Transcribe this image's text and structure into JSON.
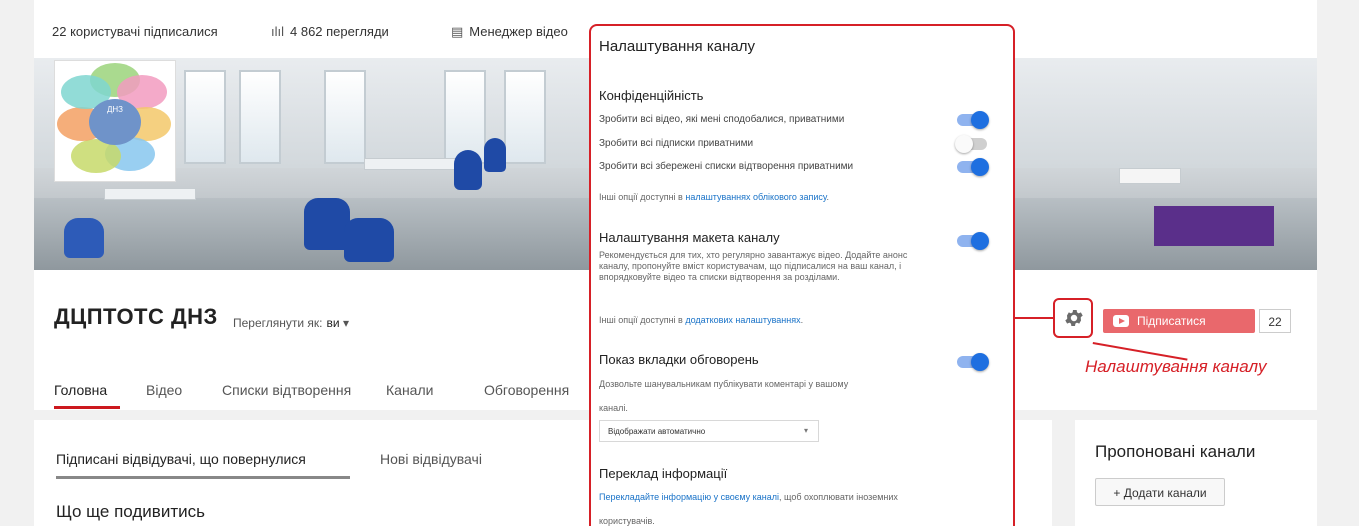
{
  "stats": {
    "subscribers": "22 користувачі підписалися",
    "views": "4 862 перегляди",
    "video_manager": "Менеджер відео"
  },
  "channel": {
    "name": "ДЦПТОТС ДНЗ",
    "view_as_label": "Переглянути як:",
    "view_as_value": "ви"
  },
  "tabs": [
    "Головна",
    "Відео",
    "Списки відтворення",
    "Канали",
    "Обговорення"
  ],
  "subscribe": {
    "label": "Підписатися",
    "count": "22"
  },
  "callout": "Налаштування каналу",
  "logo_text": "ДНЗ",
  "settings": {
    "title": "Налаштування каналу",
    "privacy_heading": "Конфіденційність",
    "privacy_rows": [
      {
        "label": "Зробити всі відео, які мені сподобалися, приватними",
        "on": true
      },
      {
        "label": "Зробити всі підписки приватними",
        "on": false
      },
      {
        "label": "Зробити всі збережені списки відтворення приватними",
        "on": true
      }
    ],
    "privacy_more_prefix": "Інші опції доступні в ",
    "privacy_more_link": "налаштуваннях облікового запису",
    "privacy_more_suffix": ".",
    "layout_heading": "Налаштування макета каналу",
    "layout_desc": "Рекомендується для тих, хто регулярно завантажує відео. Додайте анонс каналу, пропонуйте вміст користувачам, що підписалися на ваш канал, і впорядковуйте відео та списки відтворення за розділами.",
    "layout_more_prefix": "Інші опції доступні в ",
    "layout_more_link": "додаткових налаштуваннях",
    "layout_more_suffix": ".",
    "discussion_heading": "Показ вкладки обговорень",
    "discussion_desc_1": "Дозвольте шанувальникам публікувати коментарі у вашому",
    "discussion_desc_2": "каналі.",
    "discussion_dropdown": "Відображати автоматично",
    "translate_heading": "Переклад інформації",
    "translate_link": "Перекладайте інформацію у своєму каналі",
    "translate_rest": ", щоб охоплювати іноземних",
    "translate_rest_2": "користувачів."
  },
  "lower": {
    "tab_returning": "Підписані відвідувачі, що повернулися",
    "tab_new": "Нові відвідувачі",
    "more_title": "Що ще подивитись"
  },
  "side": {
    "title": "Пропоновані канали",
    "add_button": "+ Додати канали"
  },
  "colors": {
    "accent_red": "#d62027",
    "toggle_blue": "#1e6fe0",
    "subscribe": "#e9686c"
  }
}
